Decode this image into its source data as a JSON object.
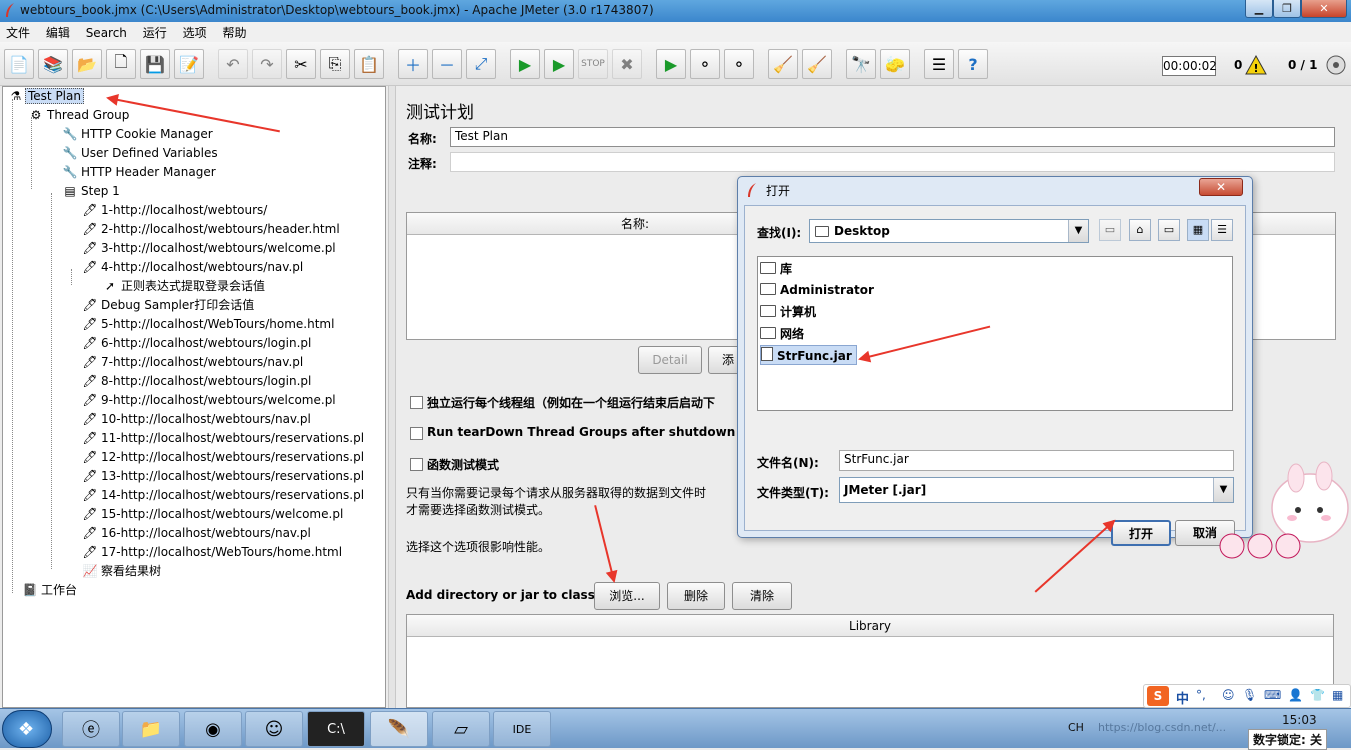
{
  "window": {
    "title": "webtours_book.jmx (C:\\Users\\Administrator\\Desktop\\webtours_book.jmx) - Apache JMeter (3.0 r1743807)",
    "min_label": "▁",
    "max_label": "❐",
    "close_label": "✕"
  },
  "menu": [
    "文件",
    "编辑",
    "Search",
    "运行",
    "选项",
    "帮助"
  ],
  "toolbar": {
    "timer": "00:00:02",
    "warnings": "0",
    "threads": "0 / 1"
  },
  "tree": {
    "root": "Test Plan",
    "thread_group": "Thread Group",
    "config": [
      "HTTP Cookie Manager",
      "User Defined Variables",
      "HTTP Header Manager"
    ],
    "step": "Step 1",
    "samplers": [
      "1-http://localhost/webtours/",
      "2-http://localhost/webtours/header.html",
      "3-http://localhost/webtours/welcome.pl",
      "4-http://localhost/webtours/nav.pl",
      "正则表达式提取登录会话值",
      "Debug Sampler打印会话值",
      "5-http://localhost/WebTours/home.html",
      "6-http://localhost/webtours/login.pl",
      "7-http://localhost/webtours/nav.pl",
      "8-http://localhost/webtours/login.pl",
      "9-http://localhost/webtours/welcome.pl",
      "10-http://localhost/webtours/nav.pl",
      "11-http://localhost/webtours/reservations.pl",
      "12-http://localhost/webtours/reservations.pl",
      "13-http://localhost/webtours/reservations.pl",
      "14-http://localhost/webtours/reservations.pl",
      "15-http://localhost/webtours/welcome.pl",
      "16-http://localhost/webtours/nav.pl",
      "17-http://localhost/WebTours/home.html"
    ],
    "listener": "察看结果树",
    "workbench": "工作台"
  },
  "panel": {
    "heading": "测试计划",
    "name_label": "名称:",
    "name_value": "Test Plan",
    "comment_label": "注释:",
    "table_header": "名称:",
    "detail_button": "Detail",
    "add_button_partial": "添",
    "checkbox_serial": "独立运行每个线程组（例如在一个组运行结束后启动下",
    "checkbox_teardown": "Run tearDown Thread Groups after shutdown of main th",
    "checkbox_functional": "函数测试模式",
    "note_line1": "只有当你需要记录每个请求从服务器取得的数据到文件时",
    "note_line2": "才需要选择函数测试模式。",
    "note_line3": "选择这个选项很影响性能。",
    "classpath_label": "Add directory or jar to classpath",
    "browse_button": "浏览...",
    "delete_button": "删除",
    "clear_button": "清除",
    "library_header": "Library"
  },
  "dialog": {
    "title": "打开",
    "title_faint": "                ",
    "close_label": "✕",
    "lookin_label": "查找(I):",
    "lookin_value": "Desktop",
    "files": [
      "库",
      "Administrator",
      "计算机",
      "网络",
      "StrFunc.jar"
    ],
    "selected_file": "StrFunc.jar",
    "filename_label": "文件名(N):",
    "filename_value": "StrFunc.jar",
    "filetype_label": "文件类型(T):",
    "filetype_value": "JMeter [.jar]",
    "open_button": "打开",
    "cancel_button": "取消"
  },
  "taskbar": {
    "lang": "CH",
    "clock": "15:03",
    "watermark": "https://blog.csdn.net/...",
    "numlock": "数字锁定: 关"
  },
  "ime": {
    "label": "中"
  },
  "colors": {
    "arrow": "#e8362b",
    "selection": "#c9dcf5",
    "title_bar": "#3b86cc"
  }
}
